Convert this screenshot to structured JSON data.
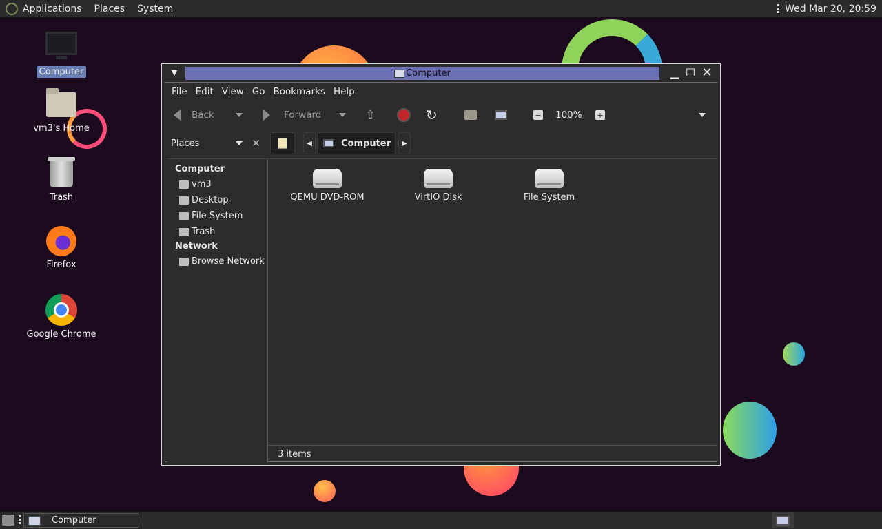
{
  "top_panel": {
    "menus": [
      "Applications",
      "Places",
      "System"
    ],
    "clock": "Wed Mar 20, 20:59"
  },
  "desktop": {
    "icons": [
      {
        "label": "Computer",
        "icon": "computer-icon",
        "selected": true
      },
      {
        "label": "vm3's Home",
        "icon": "home-folder-icon",
        "selected": false
      },
      {
        "label": "Trash",
        "icon": "trash-icon",
        "selected": false
      },
      {
        "label": "Firefox",
        "icon": "firefox-icon",
        "selected": false
      },
      {
        "label": "Google Chrome",
        "icon": "chrome-icon",
        "selected": false
      }
    ]
  },
  "window": {
    "title": "Computer",
    "menubar": [
      "File",
      "Edit",
      "View",
      "Go",
      "Bookmarks",
      "Help"
    ],
    "toolbar": {
      "back": "Back",
      "forward": "Forward",
      "zoom": "100%"
    },
    "location": {
      "places_label": "Places",
      "path": "Computer"
    },
    "sidebar": {
      "sections": [
        {
          "title": "Computer",
          "items": [
            "vm3",
            "Desktop",
            "File System",
            "Trash"
          ]
        },
        {
          "title": "Network",
          "items": [
            "Browse Network"
          ]
        }
      ]
    },
    "files": [
      "QEMU DVD-ROM",
      "VirtIO Disk",
      "File System"
    ],
    "status": "3 items"
  },
  "bottom_panel": {
    "task_label": "Computer"
  },
  "colors": {
    "title_highlight": "#6b6fb4",
    "selection": "#6a7fb6",
    "desktop_bg": "#1c0b1e"
  }
}
